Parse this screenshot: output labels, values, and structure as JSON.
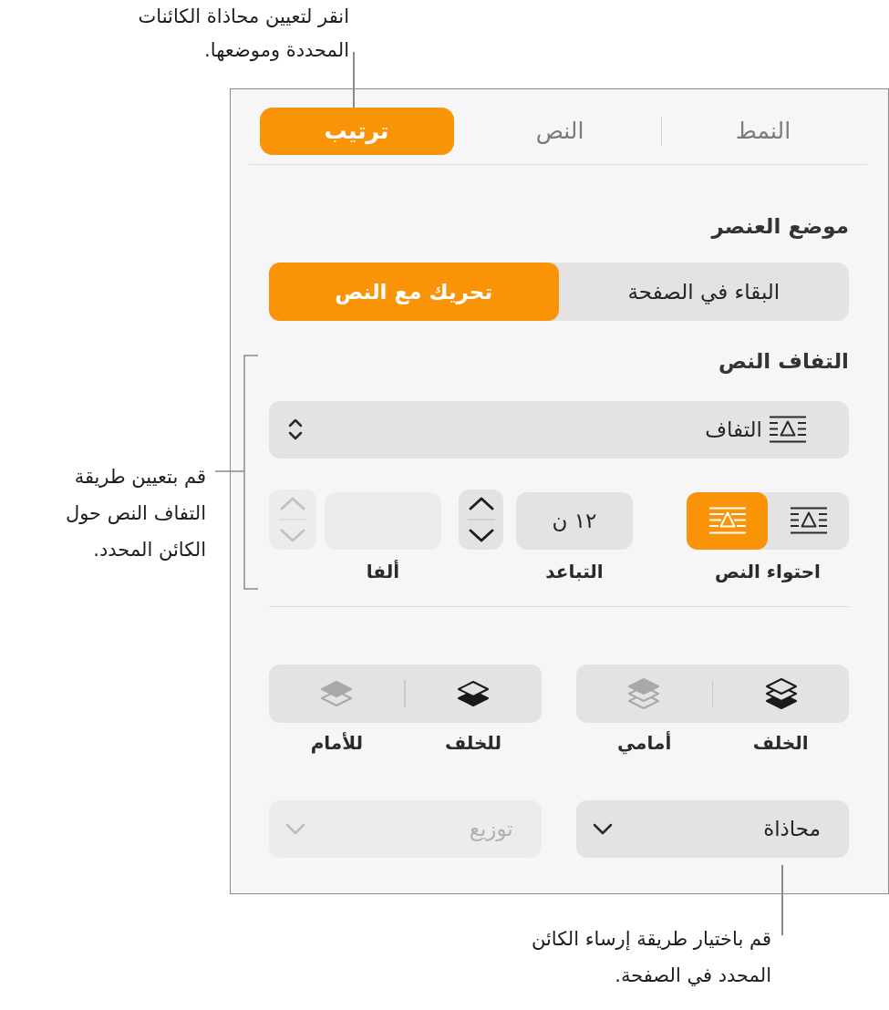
{
  "top_callout": {
    "lines": [
      "انقر لتعيين محاذاة الكائنات",
      "المحددة وموضعها."
    ]
  },
  "inspector": {
    "tabs": [
      {
        "label": "النمط",
        "selected": false
      },
      {
        "label": "النص",
        "selected": false
      },
      {
        "label": "ترتيب",
        "selected": true
      }
    ],
    "object_placement": {
      "heading": "موضع العنصر",
      "options": [
        {
          "label": "البقاء في الصفحة",
          "selected": false
        },
        {
          "label": "تحريك مع النص",
          "selected": true
        }
      ]
    },
    "text_wrap": {
      "heading": "التفاف النص",
      "wrap_popup": {
        "value": "التفاف"
      },
      "text_fit": {
        "label": "احتواء النص",
        "options": [
          {
            "kind": "box",
            "selected": false
          },
          {
            "kind": "contour",
            "selected": true
          }
        ]
      },
      "spacing": {
        "label": "التباعد",
        "value": "١٢ ن",
        "disabled": false
      },
      "alpha": {
        "label": "ألفا",
        "disabled": true
      }
    },
    "layer_groups": [
      {
        "buttons": [
          {
            "label": "الخلف",
            "kind": "back",
            "disabled": false
          },
          {
            "label": "أمامي",
            "kind": "front",
            "disabled": true
          }
        ]
      },
      {
        "buttons": [
          {
            "label": "للخلف",
            "kind": "backward",
            "disabled": false
          },
          {
            "label": "للأمام",
            "kind": "forward",
            "disabled": true
          }
        ]
      }
    ],
    "popups": [
      {
        "label": "محاذاة",
        "disabled": false
      },
      {
        "label": "توزيع",
        "disabled": true
      }
    ]
  },
  "side_callout": {
    "lines": [
      "قم بتعيين طريقة",
      "التفاف النص حول",
      "الكائن المحدد."
    ]
  },
  "bottom_callout": {
    "lines": [
      "قم باختيار طريقة إرساء الكائن",
      "المحدد في الصفحة."
    ]
  }
}
